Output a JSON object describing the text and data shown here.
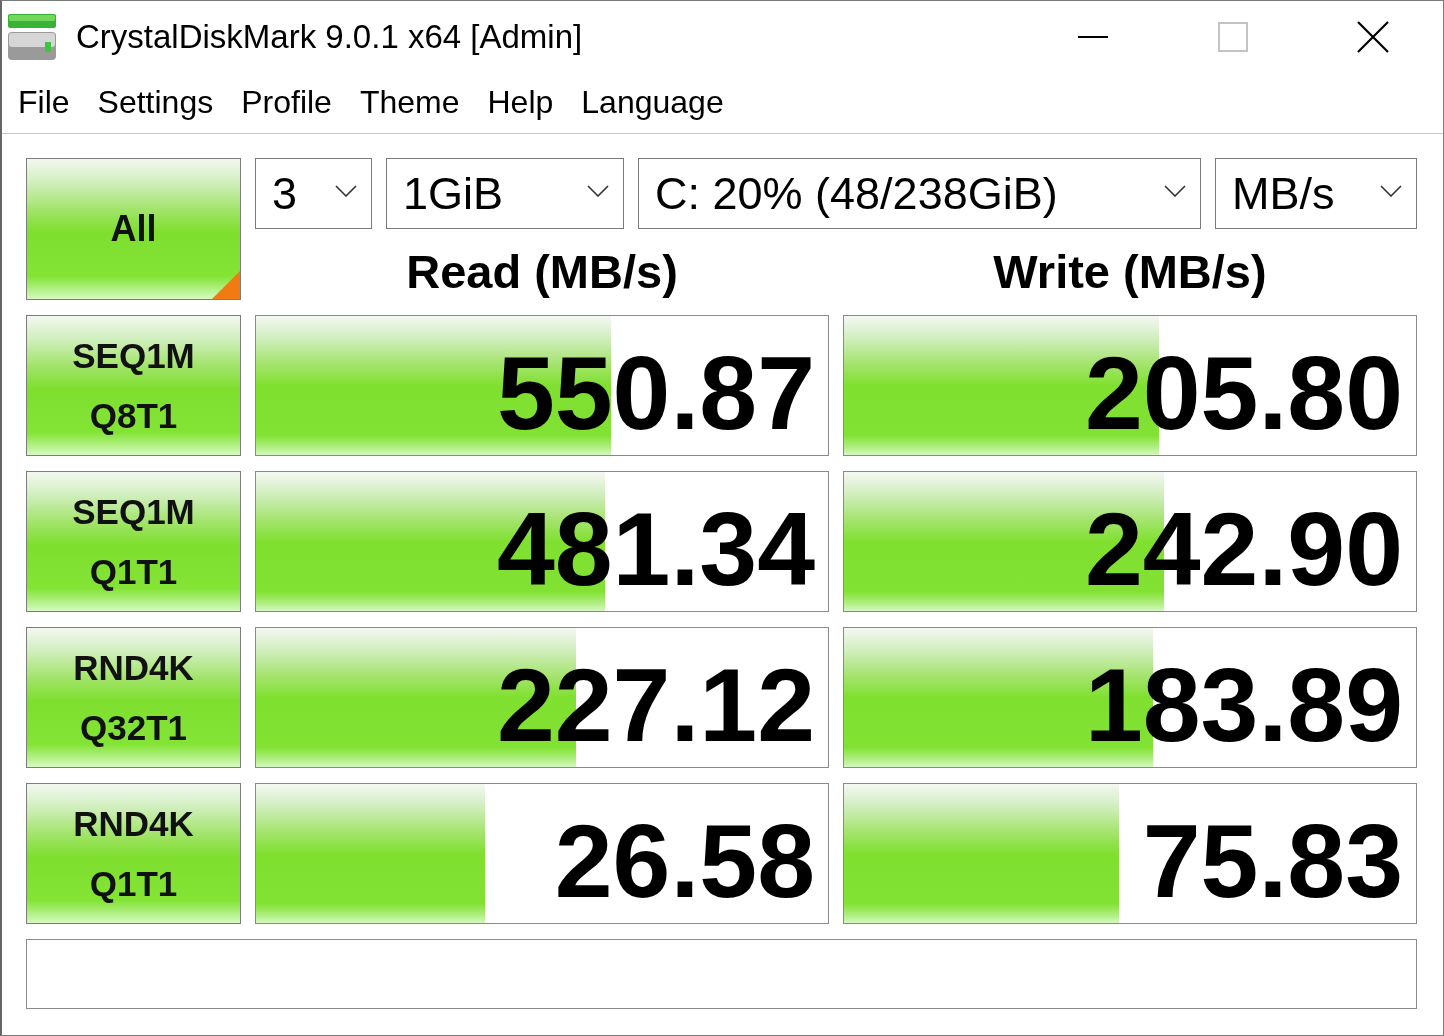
{
  "window": {
    "title": "CrystalDiskMark 9.0.1 x64 [Admin]",
    "maximize_disabled": true
  },
  "menu": [
    "File",
    "Settings",
    "Profile",
    "Theme",
    "Help",
    "Language"
  ],
  "controls": {
    "all_button": "All",
    "runs": "3",
    "size": "1GiB",
    "drive": "C: 20% (48/238GiB)",
    "unit": "MB/s"
  },
  "columns": [
    "Read (MB/s)",
    "Write (MB/s)"
  ],
  "tests": [
    {
      "name": "SEQ1M",
      "params": "Q8T1",
      "read": {
        "value": "550.87",
        "level": 0.62
      },
      "write": {
        "value": "205.80",
        "level": 0.55
      }
    },
    {
      "name": "SEQ1M",
      "params": "Q1T1",
      "read": {
        "value": "481.34",
        "level": 0.61
      },
      "write": {
        "value": "242.90",
        "level": 0.56
      }
    },
    {
      "name": "RND4K",
      "params": "Q32T1",
      "read": {
        "value": "227.12",
        "level": 0.56
      },
      "write": {
        "value": "183.89",
        "level": 0.54
      }
    },
    {
      "name": "RND4K",
      "params": "Q1T1",
      "read": {
        "value": "26.58",
        "level": 0.4
      },
      "write": {
        "value": "75.83",
        "level": 0.48
      }
    }
  ]
}
